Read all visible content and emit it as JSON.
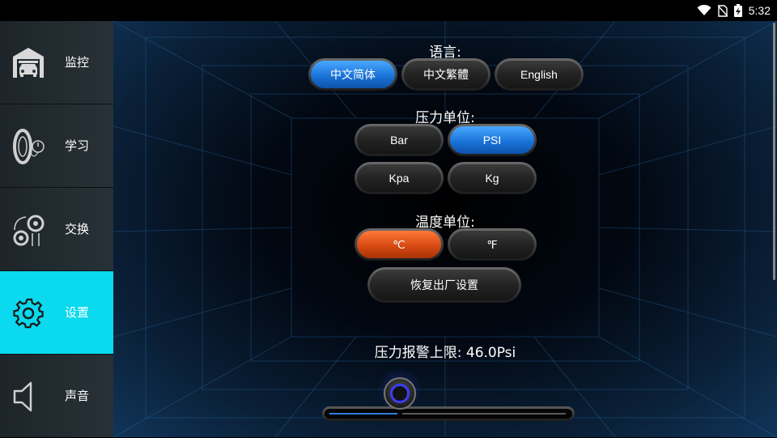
{
  "status_bar": {
    "time": "5:32",
    "icons": [
      "wifi-icon",
      "no-sim-icon",
      "battery-charging-icon"
    ]
  },
  "sidebar": {
    "items": [
      {
        "label": "监控",
        "icon": "garage-car-icon",
        "active": false
      },
      {
        "label": "学习",
        "icon": "tire-gauge-icon",
        "active": false
      },
      {
        "label": "交换",
        "icon": "tire-swap-icon",
        "active": false
      },
      {
        "label": "设置",
        "icon": "gear-icon",
        "active": true
      },
      {
        "label": "声音",
        "icon": "speaker-icon",
        "active": false
      }
    ]
  },
  "settings": {
    "language": {
      "title": "语言:",
      "options": [
        "中文简体",
        "中文繁體",
        "English"
      ],
      "selected": "中文简体"
    },
    "pressure_unit": {
      "title": "压力单位:",
      "options": [
        "Bar",
        "PSI",
        "Kpa",
        "Kg"
      ],
      "selected": "PSI"
    },
    "temperature_unit": {
      "title": "温度单位:",
      "options": [
        "℃",
        "℉"
      ],
      "selected": "℃"
    },
    "factory_reset_label": "恢复出厂设置",
    "alarm": {
      "label": "压力报警上限:",
      "value": "46.0Psi",
      "slider_fraction": 0.3
    }
  },
  "colors": {
    "accent_cyan": "#0ad9ee",
    "selected_blue": "#1b73d8",
    "selected_orange": "#d74a12"
  }
}
